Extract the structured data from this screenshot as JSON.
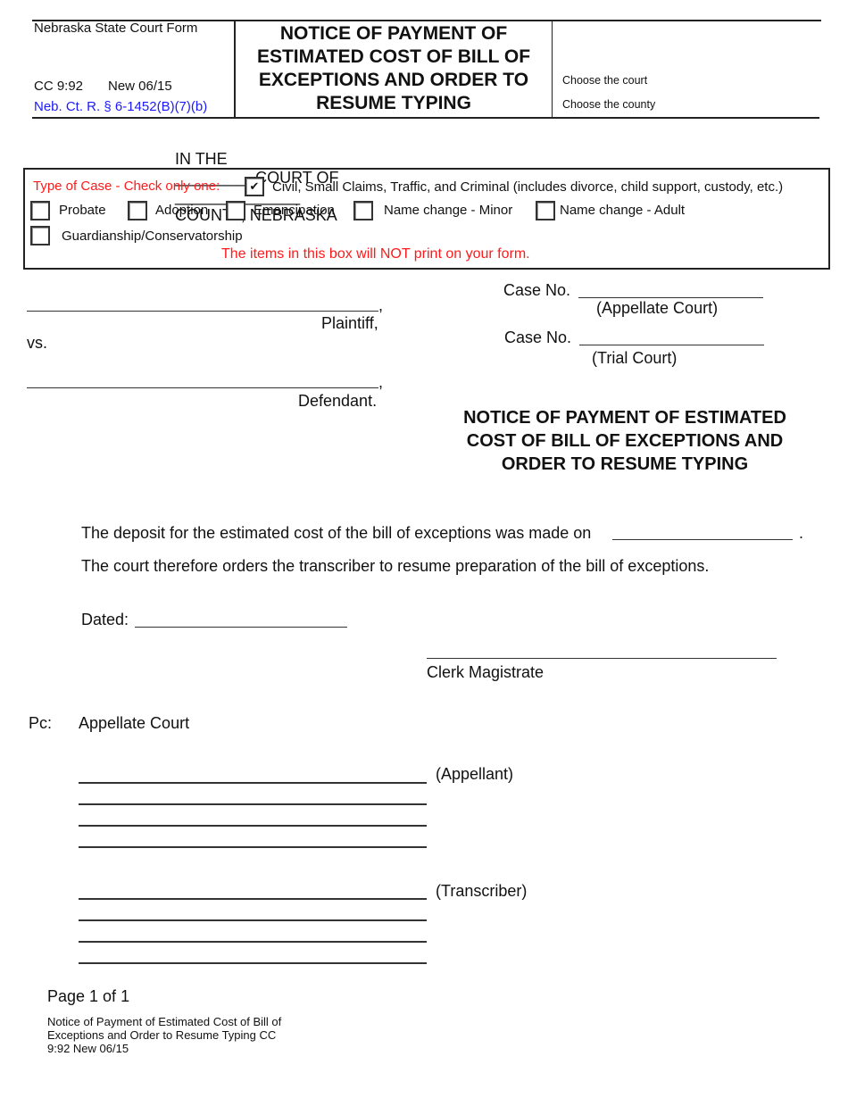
{
  "header": {
    "agency": "Nebraska State Court Form",
    "form_code": "CC 9:92",
    "form_version": "New 06/15",
    "rule_reference": "Neb. Ct. R. § 6-1452(B)(7)(b)",
    "title_lines": [
      "NOTICE OF PAYMENT OF",
      "ESTIMATED COST OF BILL OF",
      "EXCEPTIONS AND ORDER TO",
      "RESUME TYPING"
    ],
    "choose_court_label": "Choose the court",
    "choose_county_label": "Choose the county"
  },
  "court_line": {
    "in_the": "IN THE",
    "court_blank": "_________",
    "court_of": "COURT OF",
    "county_blank": "______________",
    "county_nebraska": "COUNTY, NEBRASKA"
  },
  "case_type": {
    "label": "Type of Case - Check only one:",
    "options": [
      {
        "label": "Civil, Small Claims, Traffic, and  Criminal (includes divorce, child support, custody, etc.)",
        "checked": true
      },
      {
        "label": "Probate",
        "checked": false
      },
      {
        "label": "Adoption",
        "checked": false
      },
      {
        "label": "Emancipation",
        "checked": false
      },
      {
        "label": "Name change - Minor",
        "checked": false
      },
      {
        "label": "Name change - Adult",
        "checked": false
      },
      {
        "label": "Guardianship/Conservatorship",
        "checked": false
      }
    ],
    "check_glyph": "✔",
    "notice": "The items in this box will NOT print on your form."
  },
  "parties": {
    "plaintiff_comma": ",",
    "plaintiff_label": "Plaintiff,",
    "vs": "vs.",
    "defendant_comma": ",",
    "defendant_label": "Defendant."
  },
  "case_numbers": {
    "appellate_label": "Case No.",
    "appellate_blank": "____________________",
    "appellate_caption": "(Appellate Court)",
    "trial_label": "Case No.",
    "trial_blank": "____________________",
    "trial_caption": "(Trial Court)"
  },
  "body_title_lines": [
    "NOTICE OF PAYMENT OF ESTIMATED",
    "COST OF BILL OF EXCEPTIONS AND",
    "ORDER TO RESUME TYPING"
  ],
  "body": {
    "deposit_text": "The deposit for the estimated cost of the bill of exceptions was made on",
    "deposit_blank": "___________________",
    "deposit_period": ".",
    "order_text": "The court therefore orders the transcriber to resume preparation of the bill of exceptions.",
    "dated_label": "Dated:",
    "dated_blank": "______________________",
    "signature_caption": "Clerk Magistrate"
  },
  "pc": {
    "label": "Pc:",
    "appellate_court": "Appellate Court",
    "appellant_caption": "(Appellant)",
    "transcriber_caption": "(Transcriber)"
  },
  "footer": {
    "page": "Page 1 of 1",
    "form_name_lines": [
      "Notice of Payment of Estimated Cost of Bill of",
      "Exceptions and Order to Resume Typing CC",
      "9:92 New 06/15"
    ]
  },
  "colors": {
    "instruction_red": "#ff1a1a",
    "rule_blue": "#1a1aff"
  }
}
